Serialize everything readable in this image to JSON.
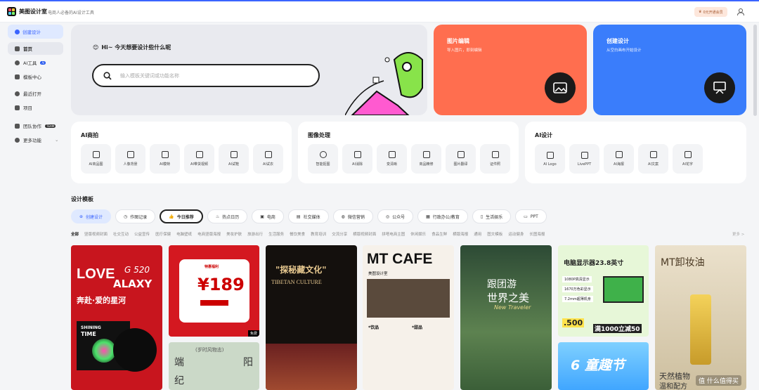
{
  "header": {
    "brand": "美图设计室",
    "slogan": "电商人必备的AI设计工具",
    "vip": "0元开通会员"
  },
  "sidebar": {
    "create": "创建设计",
    "items": [
      "首页",
      "AI工具",
      "模板中心",
      "最近打开",
      "项目",
      "团队协作",
      "更多功能"
    ],
    "ai_tag": "AI",
    "team_tag": "TEAM"
  },
  "hero": {
    "title": "Hi~ 今天想要设计些什么呢",
    "placeholder": "输入模板关键词或功能名称"
  },
  "promo": [
    {
      "title": "图片编辑",
      "sub": "导入图片，即刻编辑",
      "color": "#ff6e4f"
    },
    {
      "title": "创建设计",
      "sub": "从空白画布开始设计",
      "color": "#3a7dfb"
    }
  ],
  "tools": [
    {
      "title": "AI商拍",
      "items": [
        "AI商品图",
        "人像背景",
        "AI模特",
        "AI带货视频",
        "AI试鞋",
        "AI试衣"
      ]
    },
    {
      "title": "图像处理",
      "items": [
        "智能抠图",
        "AI消除",
        "变清晰",
        "商品精修",
        "图片翻译",
        "证件照"
      ]
    },
    {
      "title": "AI设计",
      "items": [
        "AI Logo",
        "LivePPT",
        "AI海报",
        "AI文案",
        "AI花字"
      ]
    }
  ],
  "templates": {
    "title": "设计模板",
    "chips": [
      "创建设计",
      "作图记录",
      "今日推荐",
      "热点日历",
      "电商",
      "社交媒体",
      "微信营销",
      "公众号",
      "行政办公/教育",
      "生活娱乐",
      "PPT"
    ],
    "cats": [
      "全部",
      "竖版视频封面",
      "社交互动",
      "公益宣传",
      "医疗保健",
      "电脑壁纸",
      "电商竖版海报",
      "美妆护肤",
      "旅游出行",
      "生活服务",
      "餐饮美食",
      "教育培训",
      "交流分享",
      "横版视频封面",
      "拼嗒电商主图",
      "休闲娱乐",
      "食品生鲜",
      "横版海报",
      "通用",
      "图文模板",
      "运动健身",
      "长图海报"
    ],
    "more": "更多 >"
  },
  "cards": {
    "love": {
      "l1": "LOVE",
      "l2": "G 520",
      "l3": "ALAXY",
      "l4": "奔赴·爱的星河",
      "l5": "SHINING",
      "l6": "TIME"
    },
    "price": {
      "top": "特惠福利",
      "num": "189",
      "free": "免费"
    },
    "tibet": {
      "t1": "\"探秘藏文化\"",
      "t2": "TIBETAN CULTURE"
    },
    "cafe": {
      "t1": "MT CAFE",
      "t2": "美图设计室",
      "m1": "*饮品",
      "m2": "*甜品"
    },
    "travel": {
      "t1": "跟团游",
      "t2": "世界之美",
      "t3": "New Traveler"
    },
    "pc": {
      "t1": "电脑显示器23.8英寸",
      "price": ".500",
      "p2": "满1000立减50",
      "f1": "1080P高清显示",
      "f2": "1670万色彩显示",
      "f3": "7.2mm超薄机身"
    },
    "kids": {
      "t1": "6 童趣节"
    },
    "oil": {
      "t1": "MT卸妆油",
      "t2": "天然植物",
      "t3": "温和配方"
    },
    "season": {
      "t1": "(岁时风物志)",
      "t2": "端",
      "t3": "阳",
      "t4": "纪"
    }
  },
  "watermark": "值 什么值得买"
}
